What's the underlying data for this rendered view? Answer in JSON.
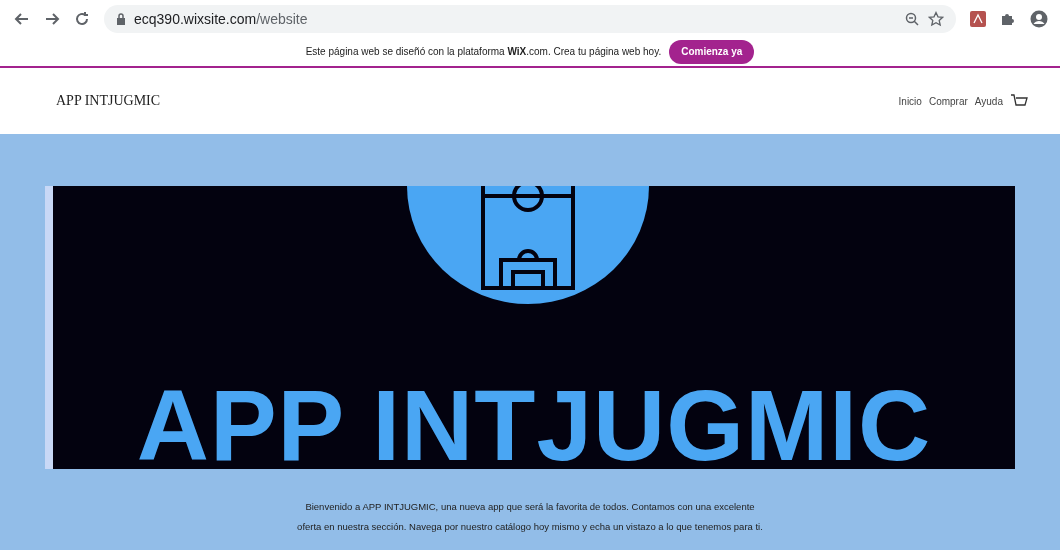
{
  "browser": {
    "url_host": "ecq390.wixsite.com",
    "url_path": "/website"
  },
  "wix_bar": {
    "message": "Este página web se diseñó con la plataforma **WiX**.com. Crea tu página web hoy.",
    "button": "Comienza ya"
  },
  "header": {
    "site_title": "APP INTJUGMIC",
    "nav": [
      {
        "label": "Inicio"
      },
      {
        "label": "Comprar"
      },
      {
        "label": "Ayuda"
      }
    ]
  },
  "hero": {
    "banner_text": "APP INTJUGMIC",
    "intro": "Bienvenido a APP INTJUGMIC, una nueva app que será la favorita de todos. Contamos con una excelente oferta en nuestra sección. Navega por nuestro catálogo hoy mismo y echa un vistazo a lo que tenemos para ti."
  }
}
